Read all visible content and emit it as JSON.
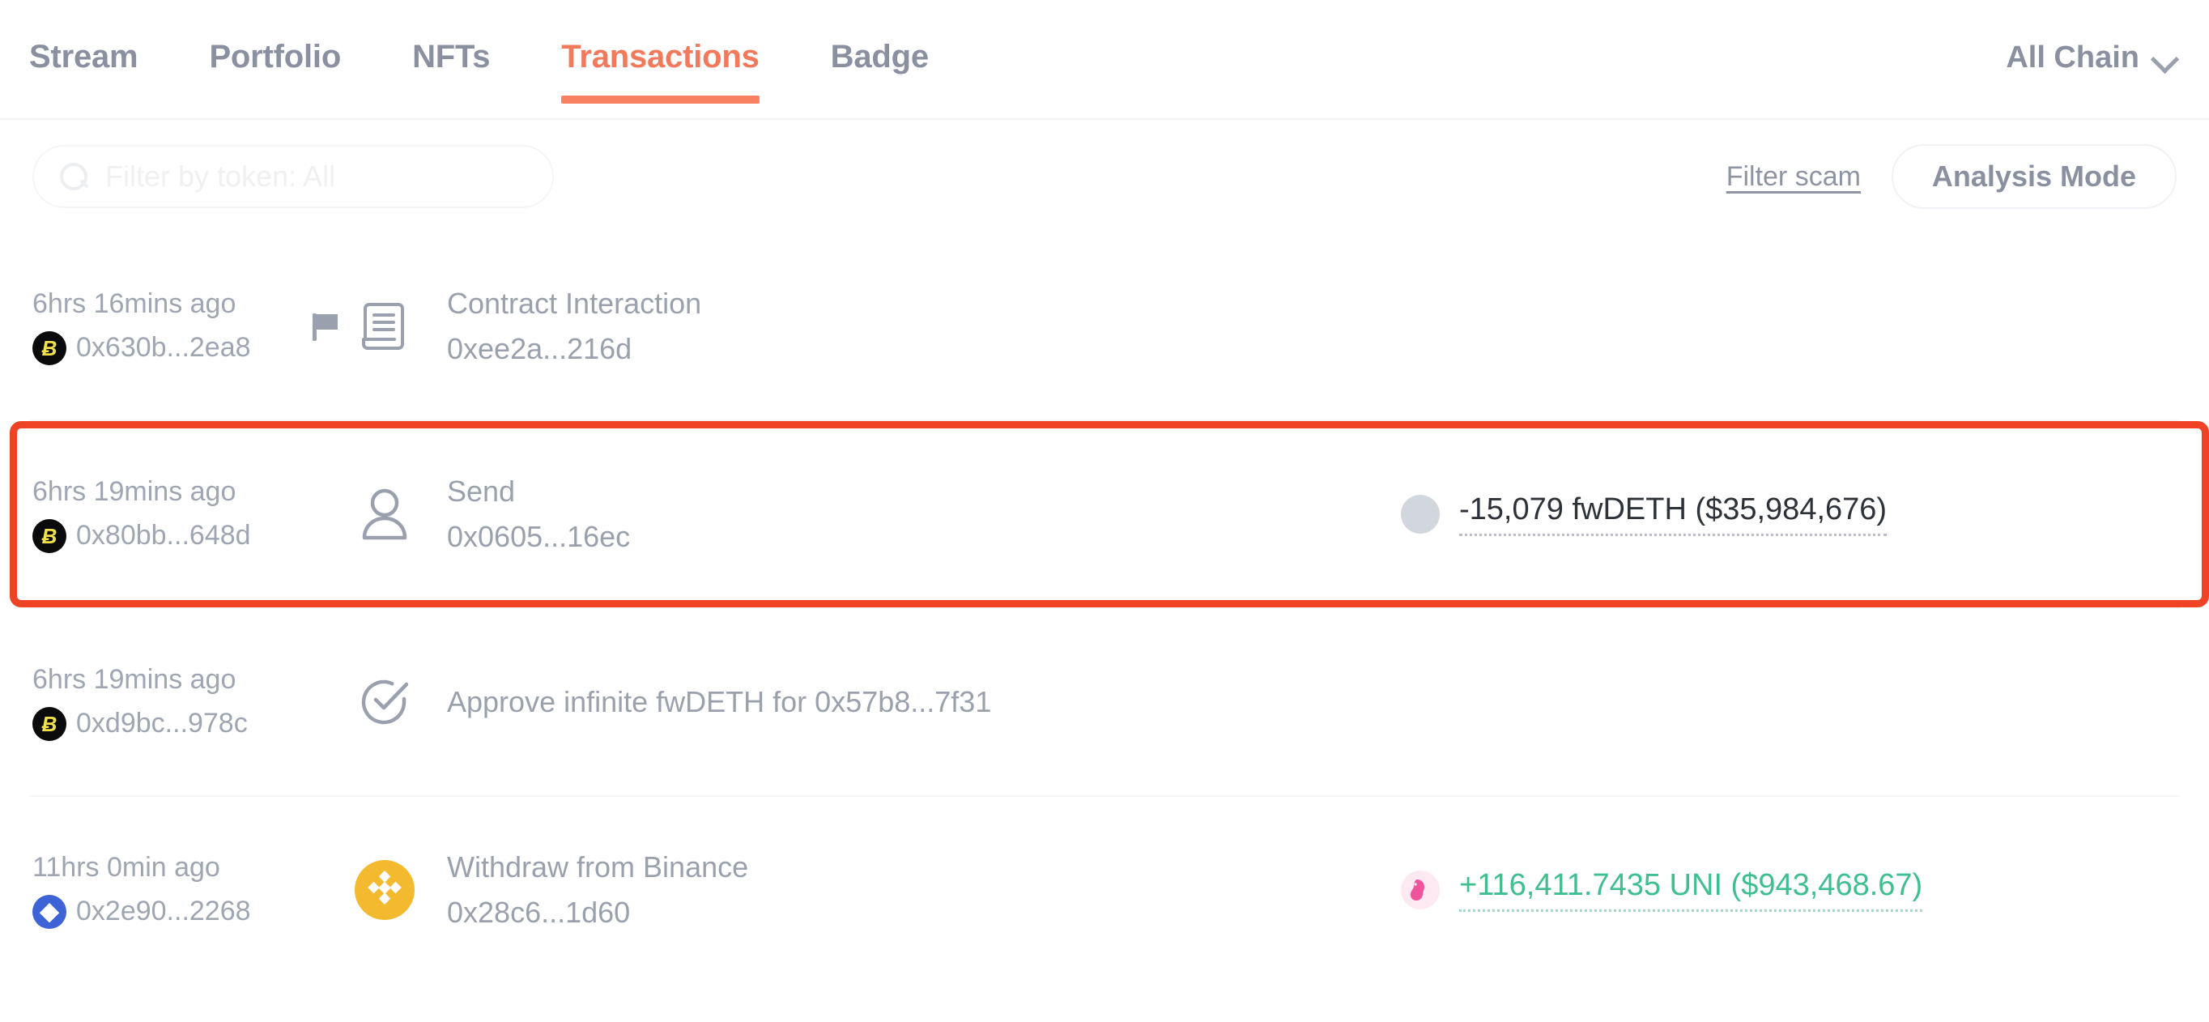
{
  "header": {
    "tabs": [
      {
        "label": "Stream",
        "active": false
      },
      {
        "label": "Portfolio",
        "active": false
      },
      {
        "label": "NFTs",
        "active": false
      },
      {
        "label": "Transactions",
        "active": true
      },
      {
        "label": "Badge",
        "active": false
      }
    ],
    "chain_filter": {
      "label": "All Chain",
      "icon": "chevron-down-icon"
    },
    "active_tab_color": "#f78160"
  },
  "filters": {
    "search": {
      "placeholder": "Filter by token: All",
      "value": "",
      "icon": "search-icon"
    },
    "filter_scam_label": "Filter scam",
    "analysis_mode_label": "Analysis Mode"
  },
  "transactions": [
    {
      "time": "6hrs 16mins ago",
      "chain_icon": "bsc-chain-icon",
      "chain_icon_glyph": "Ƀ",
      "hash": "0x630b...2ea8",
      "flagged": true,
      "type_icon": "contract-scroll-icon",
      "title": "Contract Interaction",
      "subtitle": "0xee2a...216d",
      "amount": null,
      "highlighted": false
    },
    {
      "time": "6hrs 19mins ago",
      "chain_icon": "bsc-chain-icon",
      "chain_icon_glyph": "Ƀ",
      "hash": "0x80bb...648d",
      "flagged": false,
      "type_icon": "user-icon",
      "title": "Send",
      "subtitle": "0x0605...16ec",
      "amount": {
        "token_icon": "generic-token-icon",
        "text": "-15,079 fwDETH ($35,984,676)",
        "direction": "negative"
      },
      "highlighted": true
    },
    {
      "time": "6hrs 19mins ago",
      "chain_icon": "bsc-chain-icon",
      "chain_icon_glyph": "Ƀ",
      "hash": "0xd9bc...978c",
      "flagged": false,
      "type_icon": "approve-check-icon",
      "title": "Approve infinite fwDETH for 0x57b8...7f31",
      "subtitle": "",
      "amount": null,
      "highlighted": false
    },
    {
      "time": "11hrs 0min ago",
      "chain_icon": "eth-chain-icon",
      "chain_icon_glyph": "◆",
      "hash": "0x2e90...2268",
      "flagged": false,
      "type_icon": "binance-icon",
      "title": "Withdraw from Binance",
      "subtitle": "0x28c6...1d60",
      "amount": {
        "token_icon": "uniswap-token-icon",
        "text": "+116,411.7435 UNI ($943,468.67)",
        "direction": "positive"
      },
      "highlighted": false
    }
  ],
  "colors": {
    "accent": "#f78160",
    "highlight_box": "#f04326",
    "positive": "#3fbf8f",
    "muted_text": "#9aa0ac",
    "binance_yellow": "#f3ba2f"
  }
}
